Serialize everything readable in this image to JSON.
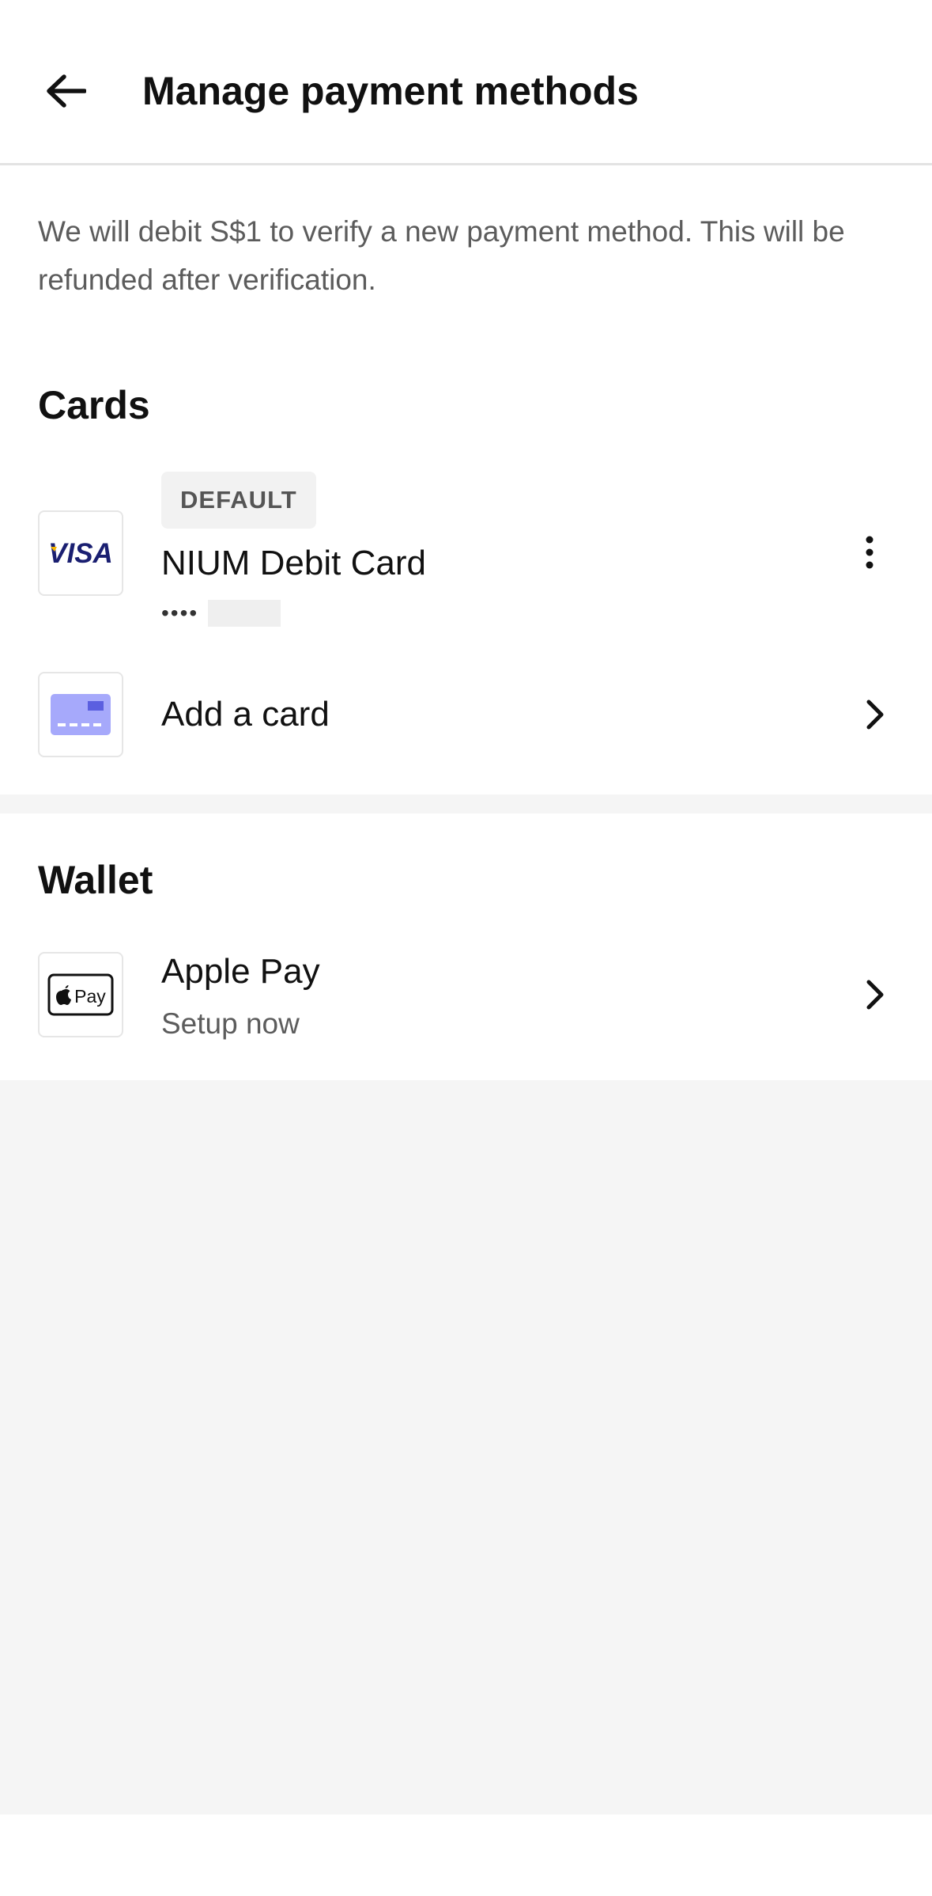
{
  "header": {
    "title": "Manage payment methods",
    "back_icon": "arrow-left-icon"
  },
  "notice": "We will debit S$1 to verify a new payment method. This will be refunded after verification.",
  "cards": {
    "section_title": "Cards",
    "default_card": {
      "badge": "DEFAULT",
      "logo": "VISA",
      "name": "NIUM Debit Card",
      "masked_prefix": "••••"
    },
    "add_card": {
      "label": "Add a card",
      "icon": "credit-card-icon"
    }
  },
  "wallet": {
    "section_title": "Wallet",
    "apple_pay": {
      "logo": "Pay",
      "label": "Apple Pay",
      "sublabel": "Setup now"
    }
  },
  "colors": {
    "visa_blue": "#1a1f71",
    "visa_gold": "#f7b600",
    "card_icon": "#a6a9fb",
    "card_icon_chip": "#5b5fe0"
  }
}
